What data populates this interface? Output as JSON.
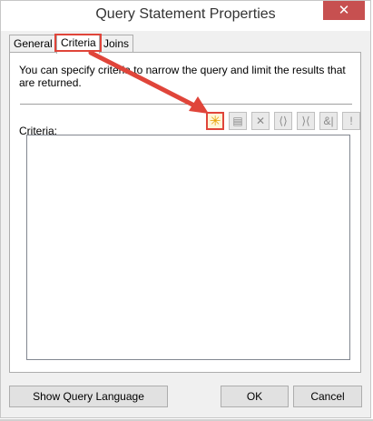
{
  "window": {
    "title": "Query Statement Properties",
    "close_glyph": "✕"
  },
  "tabs": [
    {
      "label": "General"
    },
    {
      "label": "Criteria"
    },
    {
      "label": "Joins"
    }
  ],
  "criteria_tab": {
    "description": "You can specify criteria to narrow the query and limit the results that are returned.",
    "criteria_label": "Criteria:",
    "toolbar": [
      {
        "icon": "new-criterion-icon",
        "glyph": "✳"
      },
      {
        "icon": "properties-icon",
        "glyph": "▤"
      },
      {
        "icon": "delete-icon",
        "glyph": "✕"
      },
      {
        "icon": "group-icon",
        "glyph": "⟨⟩"
      },
      {
        "icon": "ungroup-icon",
        "glyph": "⟩⟨"
      },
      {
        "icon": "and-or-icon",
        "glyph": "&|"
      },
      {
        "icon": "not-icon",
        "glyph": "!"
      }
    ]
  },
  "buttons": {
    "show_query": "Show Query Language",
    "ok": "OK",
    "cancel": "Cancel"
  },
  "colors": {
    "highlight": "#e0453a",
    "close": "#c75050"
  }
}
